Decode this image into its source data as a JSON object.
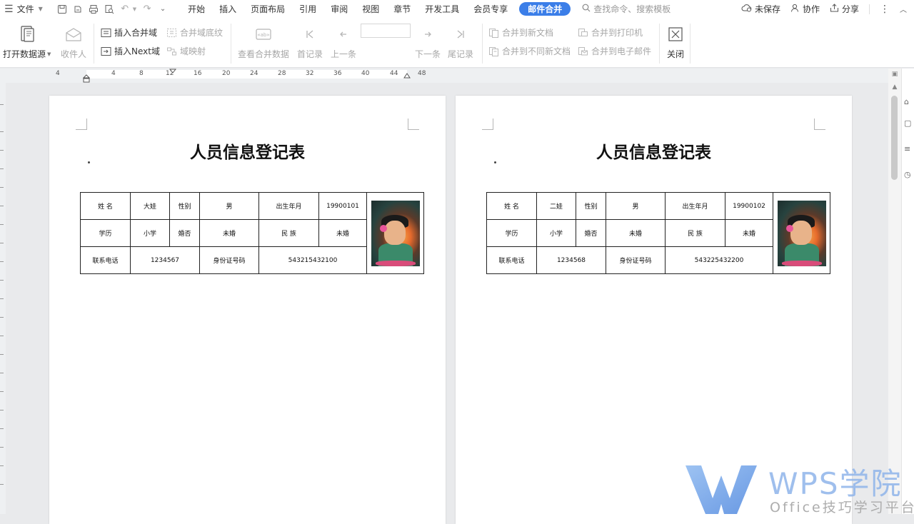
{
  "menubar": {
    "file_label": "文件",
    "tabs": [
      {
        "label": "开始"
      },
      {
        "label": "插入"
      },
      {
        "label": "页面布局"
      },
      {
        "label": "引用"
      },
      {
        "label": "审阅"
      },
      {
        "label": "视图"
      },
      {
        "label": "章节"
      },
      {
        "label": "开发工具"
      },
      {
        "label": "会员专享"
      },
      {
        "label": "邮件合并"
      }
    ],
    "active_tab": "邮件合并",
    "search_placeholder": "查找命令、搜索模板",
    "unsaved_label": "未保存",
    "collab_label": "协作",
    "share_label": "分享"
  },
  "ribbon": {
    "open_datasource": "打开数据源",
    "recipients": "收件人",
    "insert_merge_field": "插入合并域",
    "merge_field_shading": "合并域底纹",
    "insert_next_field": "插入Next域",
    "field_mapping": "域映射",
    "view_merged_data": "查看合并数据",
    "first_record": "首记录",
    "prev_record": "上一条",
    "next_record": "下一条",
    "last_record": "尾记录",
    "merge_to_new_doc": "合并到新文档",
    "merge_to_diff_docs": "合并到不同新文档",
    "merge_to_printer": "合并到打印机",
    "merge_to_email": "合并到电子邮件",
    "close": "关闭"
  },
  "ruler": {
    "numbers": [
      "4",
      "4",
      "8",
      "12",
      "16",
      "20",
      "24",
      "28",
      "32",
      "36",
      "40",
      "44",
      "48"
    ]
  },
  "pages": [
    {
      "title": "人员信息登记表",
      "labels": {
        "name": "姓  名",
        "gender": "性别",
        "birth": "出生年月",
        "education": "学历",
        "marital": "婚否",
        "ethnicity": "民  族",
        "phone": "联系电话",
        "id_number": "身份证号码"
      },
      "values": {
        "name": "大娃",
        "gender": "男",
        "birth": "19900101",
        "education": "小学",
        "marital": "未婚",
        "ethnicity": "未婚",
        "phone": "1234567",
        "id_number": "543215432100"
      }
    },
    {
      "title": "人员信息登记表",
      "labels": {
        "name": "姓  名",
        "gender": "性别",
        "birth": "出生年月",
        "education": "学历",
        "marital": "婚否",
        "ethnicity": "民  族",
        "phone": "联系电话",
        "id_number": "身份证号码"
      },
      "values": {
        "name": "二娃",
        "gender": "男",
        "birth": "19900102",
        "education": "小学",
        "marital": "未婚",
        "ethnicity": "未婚",
        "phone": "1234568",
        "id_number": "543225432200"
      }
    }
  ],
  "watermark": {
    "title": "WPS学院",
    "subtitle": "Office技巧学习平台"
  },
  "colors": {
    "accent": "#3b7ee8",
    "watermark_blue": "#8fb4ea"
  }
}
